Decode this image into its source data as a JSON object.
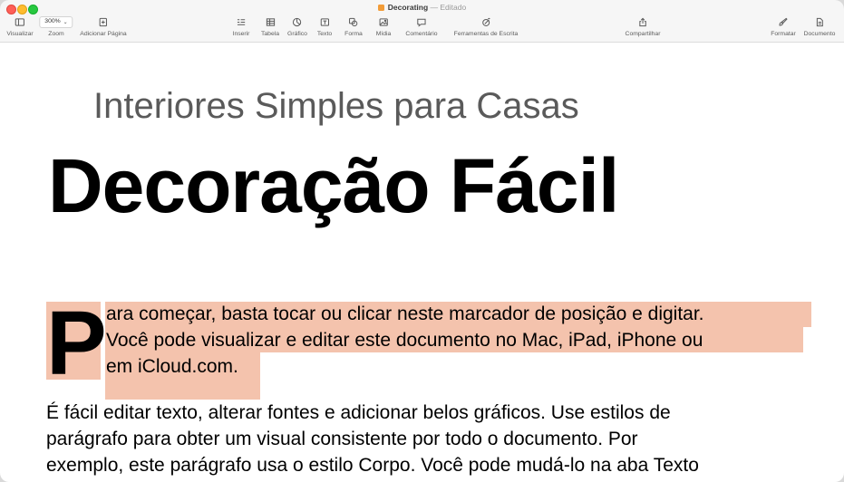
{
  "window": {
    "doc_name": "Decorating",
    "status": "— Editado"
  },
  "toolbar": {
    "visualizar": "Visualizar",
    "zoom_label": "Zoom",
    "zoom_value": "300%",
    "adicionar_pagina": "Adicionar Página",
    "inserir": "Inserir",
    "tabela": "Tabela",
    "grafico": "Gráfico",
    "texto": "Texto",
    "forma": "Forma",
    "midia": "Mídia",
    "comentario": "Comentário",
    "ferramentas_escrita": "Ferramentas de Escrita",
    "compartilhar": "Compartilhar",
    "formatar": "Formatar",
    "documento": "Documento"
  },
  "document": {
    "subtitle": "Interiores Simples para Casas",
    "headline": "Decoração Fácil",
    "drop_cap": "P",
    "para1": [
      "ara começar, basta tocar ou clicar neste marcador de posição e digitar.",
      "Você pode visualizar e editar este documento no Mac, iPad, iPhone ou",
      "em iCloud.com."
    ],
    "para2": [
      "É fácil editar texto, alterar fontes e adicionar belos gráficos. Use estilos de",
      "parágrafo para obter um visual consistente por todo o documento. Por",
      "exemplo, este parágrafo usa o estilo Corpo. Você pode mudá-lo na aba Texto"
    ],
    "highlight_color": "#f4c3ad"
  }
}
